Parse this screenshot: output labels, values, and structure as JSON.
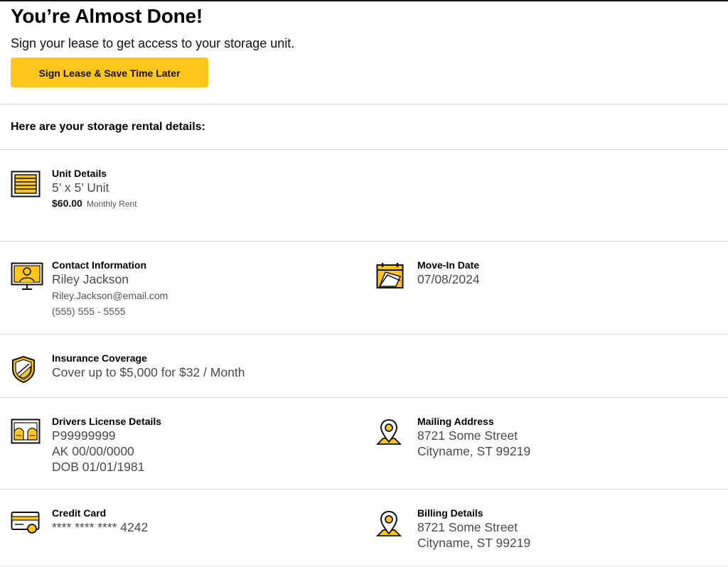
{
  "header": {
    "title": "You’re Almost Done!",
    "subtitle": "Sign your lease to get access to your storage unit.",
    "cta_label": "Sign Lease & Save Time Later"
  },
  "intro": "Here are your storage rental details:",
  "unit": {
    "label": "Unit Details",
    "size": "5’ x 5’ Unit",
    "price": "$60.00",
    "price_label": "Monthly Rent"
  },
  "contact": {
    "label": "Contact Information",
    "name": "Riley Jackson",
    "email": "Riley.Jackson@email.com",
    "phone": "(555) 555 - 5555"
  },
  "move_in": {
    "label": "Move-In Date",
    "date": "07/08/2024"
  },
  "insurance": {
    "label": "Insurance Coverage",
    "value": "Cover up to $5,000 for $32 / Month"
  },
  "license": {
    "label": "Drivers License Details",
    "number": "P99999999",
    "state_exp": "AK 00/00/0000",
    "dob": "DOB 01/01/1981"
  },
  "mailing": {
    "label": "Mailing Address",
    "line1": "8721 Some Street",
    "line2": "Cityname, ST 99219"
  },
  "card": {
    "label": "Credit Card",
    "masked": "**** **** **** 4242"
  },
  "billing": {
    "label": "Billing Details",
    "line1": "8721 Some Street",
    "line2": "Cityname, ST 99219"
  },
  "colors": {
    "accent": "#FFC61B",
    "divider": "#dcdcdc",
    "text_muted": "#4a4a4a"
  },
  "icons": [
    "storage-unit-icon",
    "monitor-user-icon",
    "calendar-icon",
    "shield-icon",
    "license-card-icon",
    "map-pin-icon",
    "credit-card-icon"
  ]
}
